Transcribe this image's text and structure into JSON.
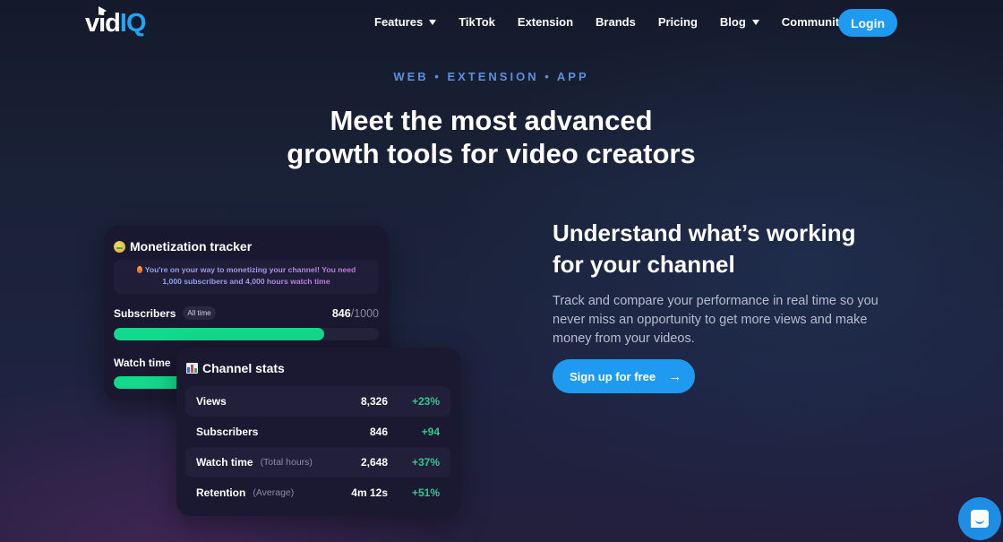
{
  "nav": {
    "logo": {
      "left": "vid",
      "right": "IQ"
    },
    "items": [
      {
        "label": "Features",
        "has_dropdown": true
      },
      {
        "label": "TikTok",
        "has_dropdown": false
      },
      {
        "label": "Extension",
        "has_dropdown": false
      },
      {
        "label": "Brands",
        "has_dropdown": false
      },
      {
        "label": "Pricing",
        "has_dropdown": false
      },
      {
        "label": "Blog",
        "has_dropdown": true
      },
      {
        "label": "Community",
        "has_dropdown": true
      }
    ],
    "login_label": "Login"
  },
  "hero": {
    "eyebrow": "WEB • EXTENSION • APP",
    "title_line1": "Meet the most advanced",
    "title_line2": "growth tools for video creators"
  },
  "monetization": {
    "icon": "money-mouth-face-emoji",
    "title": "Monetization tracker",
    "notice_icon": "fire-emoji",
    "notice_line1": "You're on your way to monetizing your channel! You need",
    "notice_line2": "1,000 subscribers and 4,000 hours watch time",
    "subscribers_label": "Subscribers",
    "period_pill": "All time",
    "subscribers_current": "846",
    "subscribers_goal": "/1000",
    "subscribers_progress": 0.846,
    "watch_label": "Watch time"
  },
  "channel_stats": {
    "icon": "bar-chart-emoji",
    "title": "Channel stats",
    "rows": [
      {
        "label": "Views",
        "note": "",
        "value": "8,326",
        "change": "+23%"
      },
      {
        "label": "Subscribers",
        "note": "",
        "value": "846",
        "change": "+94"
      },
      {
        "label": "Watch time",
        "note": "(Total hours)",
        "value": "2,648",
        "change": "+37%"
      },
      {
        "label": "Retention",
        "note": "(Average)",
        "value": "4m 12s",
        "change": "+51%"
      }
    ]
  },
  "feature": {
    "title_line1": "Understand what’s working",
    "title_line2": "for your channel",
    "body": "Track and compare your performance in real time so you never miss an opportunity to get more views and make money from your videos.",
    "cta_label": "Sign up for free",
    "cta_icon": "arrow-right"
  },
  "colors": {
    "accent": "#1e9bf0",
    "progress": "#13d98c",
    "positive": "#2ec98c",
    "eyebrow": "#5b8fe0"
  }
}
